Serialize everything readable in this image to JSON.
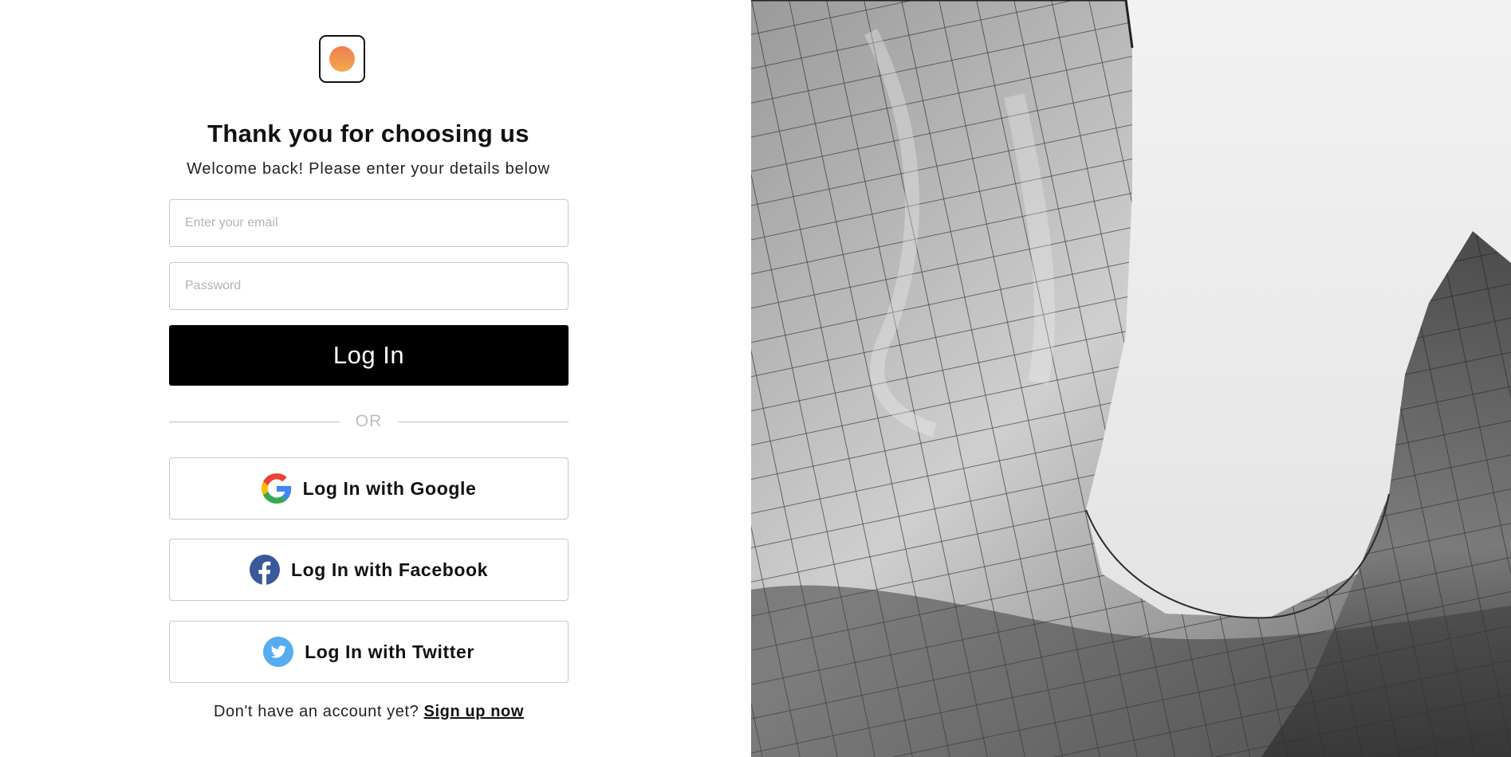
{
  "logo": {
    "icon": "sun-logo-icon",
    "colors": [
      "#f07d52",
      "#f2a94a"
    ]
  },
  "heading": {
    "title": "Thank you for choosing us",
    "subtitle": "Welcome back! Please enter your details below"
  },
  "form": {
    "email_placeholder": "Enter your email",
    "email_value": "",
    "password_placeholder": "Password",
    "password_value": "",
    "login_label": "Log In"
  },
  "divider": {
    "label": "OR"
  },
  "social": {
    "google": {
      "label": "Log In with Google",
      "icon": "google-icon"
    },
    "facebook": {
      "label": "Log In with Facebook",
      "icon": "facebook-icon",
      "color": "#3b5998"
    },
    "twitter": {
      "label": "Log In with Twitter",
      "icon": "twitter-icon",
      "color": "#55acee"
    }
  },
  "signup": {
    "prompt": "Don't have an account yet?",
    "link_label": "Sign up now"
  },
  "hero_image": {
    "subject": "architecture-photo"
  }
}
